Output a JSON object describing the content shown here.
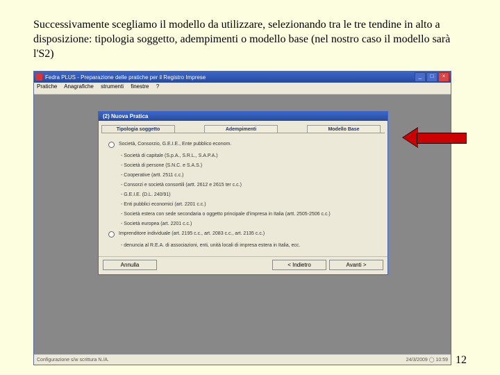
{
  "caption": "Successivamente scegliamo il modello da utilizzare, selezionando tra le tre tendine in alto a disposizione: tipologia soggetto, adempimenti o modello base (nel nostro caso il modello sarà l'S2)",
  "app": {
    "title": "Fedra PLUS - Preparazione delle pratiche per il Registro Imprese",
    "menus": [
      "Pratiche",
      "Anagrafiche",
      "strumenti",
      "finestre",
      "?"
    ]
  },
  "dialog": {
    "title": "(2) Nuova Pratica",
    "tabs": [
      "Tipologia soggetto",
      "Adempimenti",
      "Modello Base"
    ],
    "radio1": "Società, Consorzio, G.E.I.E., Ente pubblico econom.",
    "subitems": [
      "- Società di capitale (S.p.A., S.R.L., S.A.P.A.)",
      "- Società di persone (S.N.C. e S.A.S.)",
      "- Cooperative (artt. 2511 c.c.)",
      "- Consorzi e società consortili (artt. 2612 e 2615 ter c.c.)",
      "- G.E.I.E. (D.L. 240/91)",
      "- Enti pubblici economici (art. 2201 c.c.)",
      "- Società estera con sede secondaria o oggetto principale d'impresa in Italia (artt. 2505-2506 c.c.)",
      "- Società europea (art. 2201 c.c.)"
    ],
    "radio2": "Imprenditore individuale (art. 2195 c.c., art. 2083 c.c., art. 2135 c.c.)",
    "hint": "- denuncia al R.E.A. di associazioni, enti, unità locali di impresa estera in Italia, ecc.",
    "buttons": {
      "cancel": "Annulla",
      "back": "< Indietro",
      "next": "Avanti >"
    }
  },
  "status": {
    "left": "Configurazione s/w scrittura N./A.",
    "right": "24/3/2009 ◯ 10:59"
  },
  "page": "12"
}
